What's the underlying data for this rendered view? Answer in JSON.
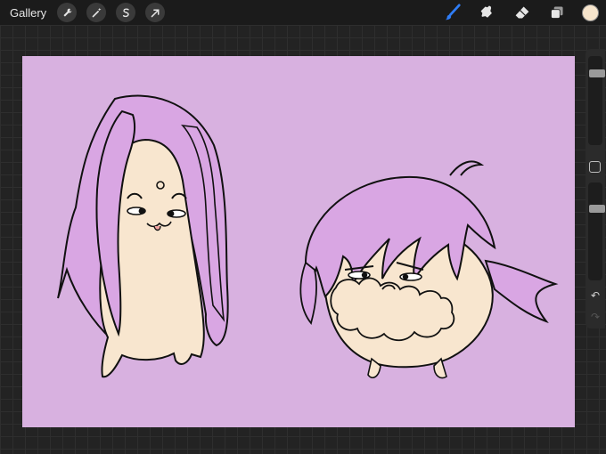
{
  "topbar": {
    "gallery_label": "Gallery",
    "left_tools": [
      "wrench-icon",
      "magic-wand-icon",
      "selection-icon",
      "transform-arrow-icon"
    ],
    "right_tools": [
      "brush-icon",
      "smudge-icon",
      "eraser-icon",
      "layers-icon"
    ],
    "active_tool": "brush-icon",
    "active_color": "#f7e5cc",
    "accent_color": "#2f7df6"
  },
  "sidebar": {
    "brush_size_level": 0.17,
    "opacity_level": 0.25,
    "undo_icon": "undo-icon",
    "redo_icon": "redo-icon"
  },
  "canvas": {
    "background_color": "#d8b1e0",
    "hair_color": "#d9a6e3",
    "skin_color": "#f8e6cf",
    "line_color": "#111111"
  }
}
